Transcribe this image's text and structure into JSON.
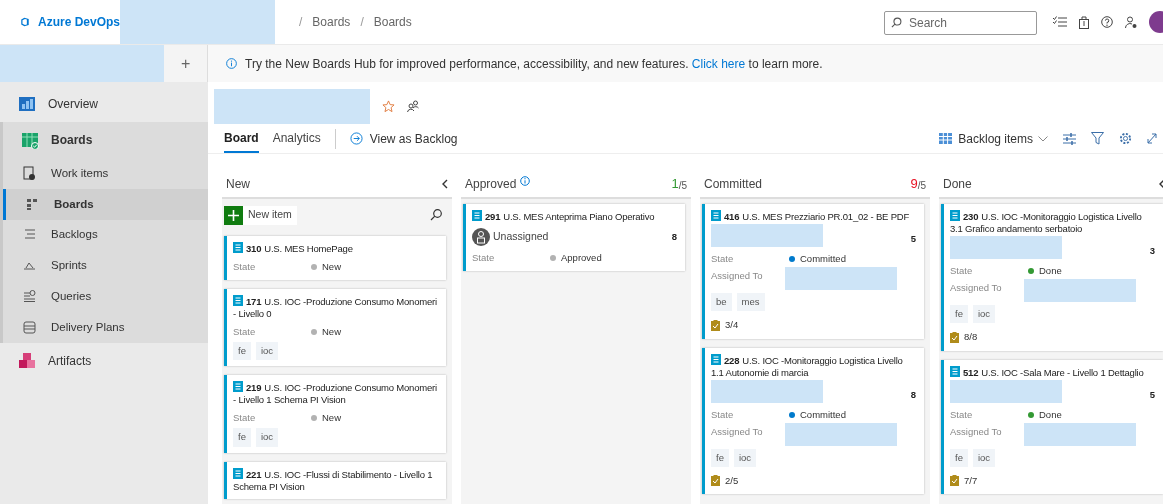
{
  "topbar": {
    "product": "Azure DevOps",
    "breadcrumb": [
      {
        "separator": "/",
        "label": "Boards"
      },
      {
        "separator": "/",
        "label": "Boards"
      }
    ],
    "search": {
      "placeholder": "Search"
    }
  },
  "banner": {
    "text": "Try the New Boards Hub for improved performance, accessibility, and new features.",
    "link": "Click here",
    "after": "to learn more."
  },
  "sidebar": {
    "add_button": "+",
    "items": [
      {
        "label": "Overview",
        "kind": "overview",
        "selected": false
      },
      {
        "label": "Boards",
        "kind": "boards",
        "selected": false,
        "children": [
          {
            "label": "Work items",
            "kind": "workitems",
            "selected": false
          },
          {
            "label": "Boards",
            "kind": "board",
            "selected": true
          },
          {
            "label": "Backlogs",
            "kind": "backlogs",
            "selected": false
          },
          {
            "label": "Sprints",
            "kind": "sprints",
            "selected": false
          },
          {
            "label": "Queries",
            "kind": "queries",
            "selected": false
          },
          {
            "label": "Delivery Plans",
            "kind": "plans",
            "selected": false
          }
        ]
      },
      {
        "label": "Artifacts",
        "kind": "artifacts",
        "selected": false
      }
    ]
  },
  "tabs": [
    {
      "label": "Board",
      "selected": true
    },
    {
      "label": "Analytics",
      "selected": false
    }
  ],
  "view_as_backlog": "View as Backlog",
  "backlog_level": "Backlog items",
  "columns": [
    {
      "name": "New",
      "info": false,
      "collapsible": true,
      "new_item": "New item",
      "cards": [
        {
          "id": "310",
          "title": "U.S. MES HomePage",
          "state_label": "State",
          "state": "New",
          "color": "#b2b2b2"
        },
        {
          "id": "171",
          "title": "U.S. IOC -Produzione Consumo Monomeri - Livello 0",
          "state_label": "State",
          "state": "New",
          "color": "#b2b2b2",
          "tags": [
            "fe",
            "ioc"
          ]
        },
        {
          "id": "219",
          "title": "U.S. IOC -Produzione Consumo Monomeri - Livello 1 Schema PI Vision",
          "state_label": "State",
          "state": "New",
          "color": "#b2b2b2",
          "tags": [
            "fe",
            "ioc"
          ]
        },
        {
          "id": "221",
          "title": "U.S. IOC -Flussi di Stabilimento - Livello 1 Schema PI Vision"
        }
      ]
    },
    {
      "name": "Approved",
      "info": true,
      "collapsible": false,
      "count": "1",
      "limit": "/5",
      "color": "#339933",
      "cards": [
        {
          "id": "291",
          "title": "U.S. MES Anteprima Piano Operativo",
          "assignee": "Unassigned",
          "effort": "8",
          "state_label": "State",
          "state": "Approved",
          "color": "#b2b2b2"
        }
      ]
    },
    {
      "name": "Committed",
      "info": false,
      "collapsible": false,
      "count": "9",
      "limit": "/5",
      "color": "#e81123",
      "cards": [
        {
          "id": "416",
          "title": "U.S. MES Prezziario PR.01_02 - BE PDF",
          "redacted": true,
          "effort": "5",
          "state_label": "State",
          "state": "Committed",
          "color": "#007acc",
          "assigned_label": "Assigned To",
          "tags": [
            "be",
            "mes"
          ],
          "tasks": "3/4"
        },
        {
          "id": "228",
          "title": "U.S. IOC -Monitoraggio Logistica Livello 1.1 Autonomie di marcia",
          "redacted": true,
          "effort": "8",
          "state_label": "State",
          "state": "Committed",
          "color": "#007acc",
          "assigned_label": "Assigned To",
          "tags": [
            "fe",
            "ioc"
          ],
          "tasks": "2/5"
        }
      ]
    },
    {
      "name": "Done",
      "info": false,
      "collapsible": true,
      "cards": [
        {
          "id": "230",
          "title": "U.S. IOC -Monitoraggio Logistica Livello 3.1 Grafico andamento serbatoio",
          "redacted": true,
          "effort": "3",
          "state_label": "State",
          "state": "Done",
          "color": "#339933",
          "assigned_label": "Assigned To",
          "tags": [
            "fe",
            "ioc"
          ],
          "tasks": "8/8"
        },
        {
          "id": "512",
          "title": "U.S. IOC -Sala Mare - Livello 1 Dettaglio",
          "redacted": true,
          "effort": "5",
          "state_label": "State",
          "state": "Done",
          "color": "#339933",
          "assigned_label": "Assigned To",
          "tags": [
            "fe",
            "ioc"
          ],
          "tasks": "7/7"
        }
      ]
    }
  ]
}
